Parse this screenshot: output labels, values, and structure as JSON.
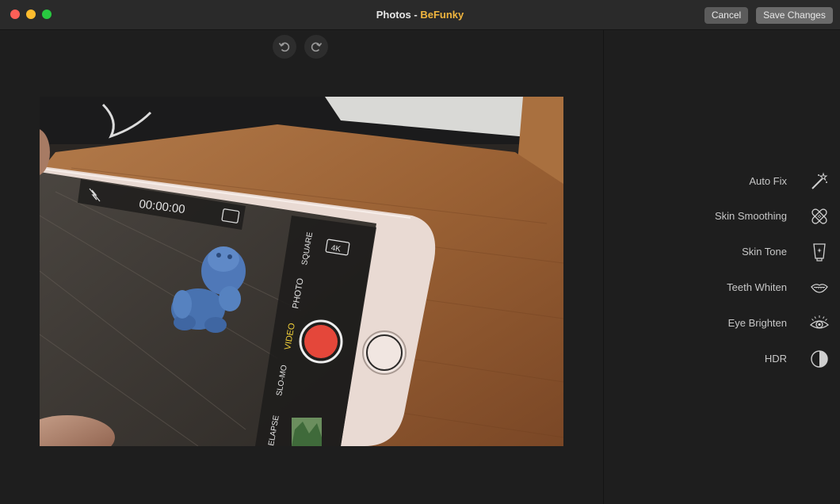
{
  "window": {
    "title_app": "Photos",
    "title_sep": " - ",
    "title_ext": "BeFunky"
  },
  "toolbar": {
    "cancel_label": "Cancel",
    "save_label": "Save Changes"
  },
  "photo": {
    "timer": "00:00:00",
    "badge_4k": "4K",
    "modes": [
      "SQUARE",
      "PHOTO",
      "VIDEO",
      "SLO-MO",
      "ELAPSE"
    ]
  },
  "tools": [
    {
      "label": "Auto Fix",
      "icon": "magic-wand-icon"
    },
    {
      "label": "Skin Smoothing",
      "icon": "bandage-icon"
    },
    {
      "label": "Skin Tone",
      "icon": "tube-icon"
    },
    {
      "label": "Teeth Whiten",
      "icon": "lips-icon"
    },
    {
      "label": "Eye Brighten",
      "icon": "eye-icon"
    },
    {
      "label": "HDR",
      "icon": "hdr-icon"
    }
  ],
  "colors": {
    "extension": "#f0b53e",
    "record": "#e4473a",
    "active_mode": "#f5d33a"
  }
}
